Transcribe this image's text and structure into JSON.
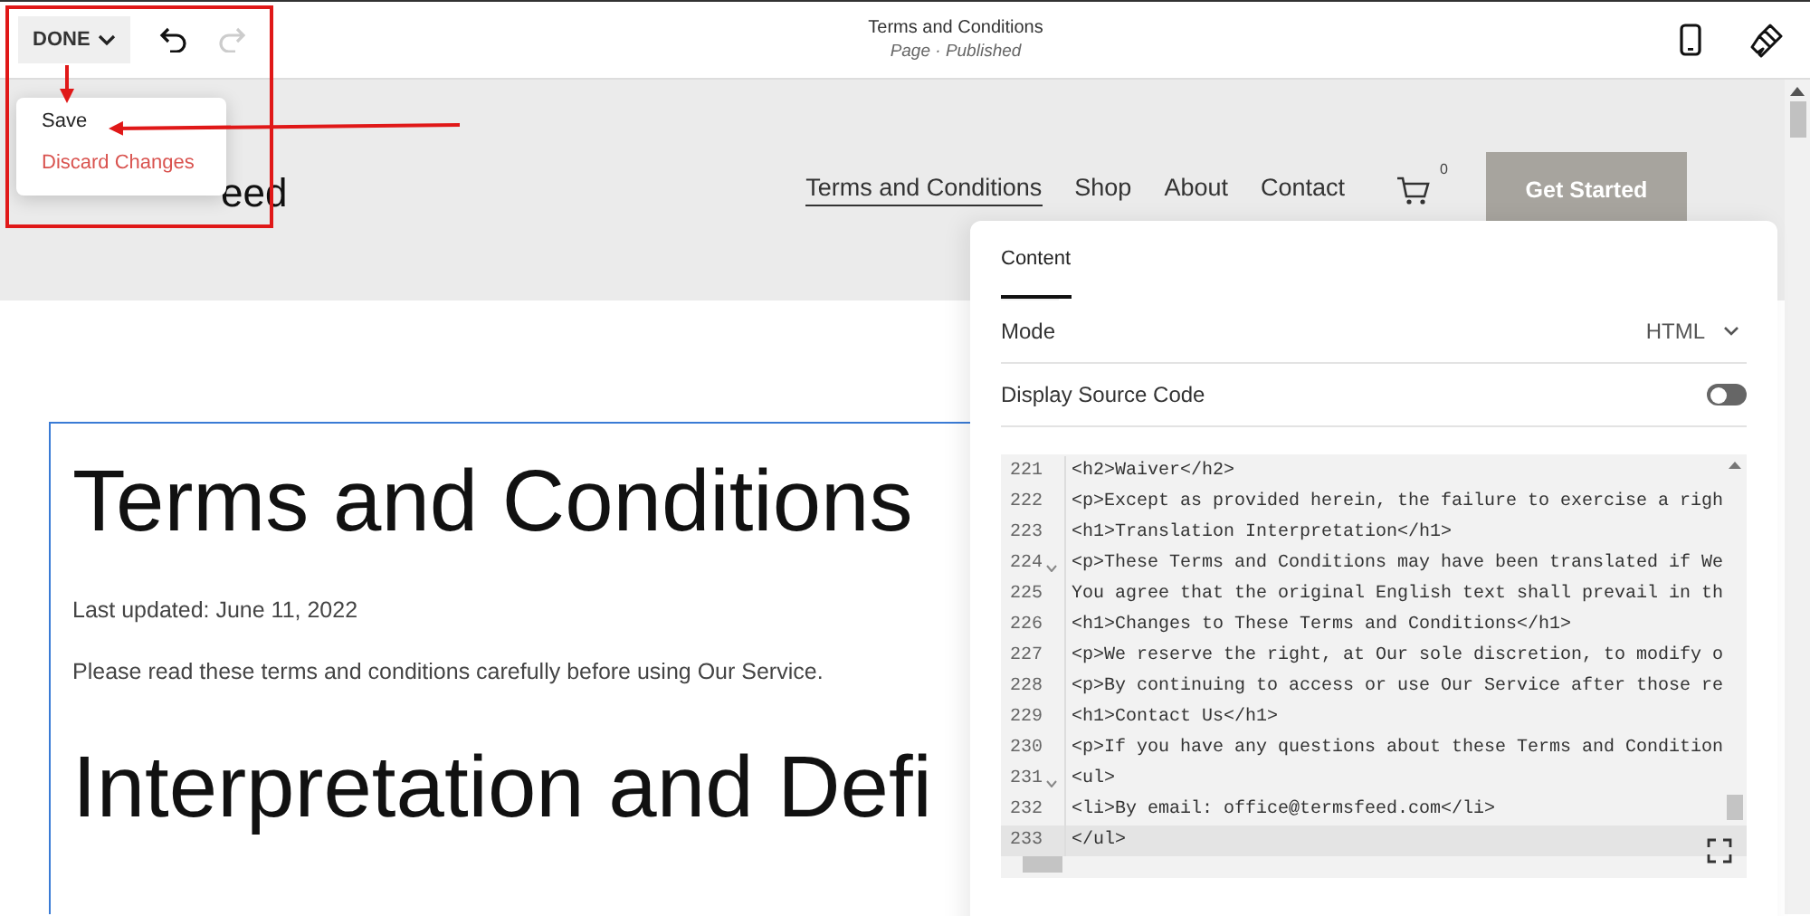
{
  "toolbar": {
    "done_label": "DONE",
    "undo_disabled": false,
    "redo_disabled": true,
    "title": "Terms and Conditions",
    "subtitle": "Page · Published"
  },
  "done_menu": [
    {
      "label": "Save",
      "kind": "normal"
    },
    {
      "label": "Discard Changes",
      "kind": "danger"
    }
  ],
  "site_header": {
    "logo": "eed",
    "nav": [
      {
        "label": "Terms and Conditions",
        "selected": true
      },
      {
        "label": "Shop",
        "selected": false
      },
      {
        "label": "About",
        "selected": false
      },
      {
        "label": "Contact",
        "selected": false
      }
    ],
    "cart_count": "0",
    "cta": "Get Started"
  },
  "page_content": {
    "heading": "Terms and Conditions",
    "updated": "Last updated: June 11, 2022",
    "intro": "Please read these terms and conditions carefully before using Our Service.",
    "heading_2": "Interpretation and Defi"
  },
  "panel": {
    "tabs": [
      {
        "label": "Content",
        "selected": true
      }
    ],
    "mode_label": "Mode",
    "mode_value": "HTML",
    "source_label": "Display Source Code",
    "source_on": false,
    "code_lines": [
      {
        "number": "221",
        "text": "<h2>Waiver</h2>",
        "foldable": false,
        "active": false
      },
      {
        "number": "222",
        "text": "<p>Except as provided herein, the failure to exercise a righ",
        "foldable": false,
        "active": false
      },
      {
        "number": "223",
        "text": "<h1>Translation Interpretation</h1>",
        "foldable": false,
        "active": false
      },
      {
        "number": "224",
        "text": "<p>These Terms and Conditions may have been translated if We",
        "foldable": true,
        "active": false
      },
      {
        "number": "225",
        "text": "You agree that the original English text shall prevail in th",
        "foldable": false,
        "active": false
      },
      {
        "number": "226",
        "text": "<h1>Changes to These Terms and Conditions</h1>",
        "foldable": false,
        "active": false
      },
      {
        "number": "227",
        "text": "<p>We reserve the right, at Our sole discretion, to modify o",
        "foldable": false,
        "active": false
      },
      {
        "number": "228",
        "text": "<p>By continuing to access or use Our Service after those re",
        "foldable": false,
        "active": false
      },
      {
        "number": "229",
        "text": "<h1>Contact Us</h1>",
        "foldable": false,
        "active": false
      },
      {
        "number": "230",
        "text": "<p>If you have any questions about these Terms and Condition",
        "foldable": false,
        "active": false
      },
      {
        "number": "231",
        "text": "<ul>",
        "foldable": true,
        "active": false
      },
      {
        "number": "232",
        "text": "<li>By email: office@termsfeed.com</li>",
        "foldable": false,
        "active": false
      },
      {
        "number": "233",
        "text": "</ul>",
        "foldable": false,
        "active": true
      }
    ]
  }
}
